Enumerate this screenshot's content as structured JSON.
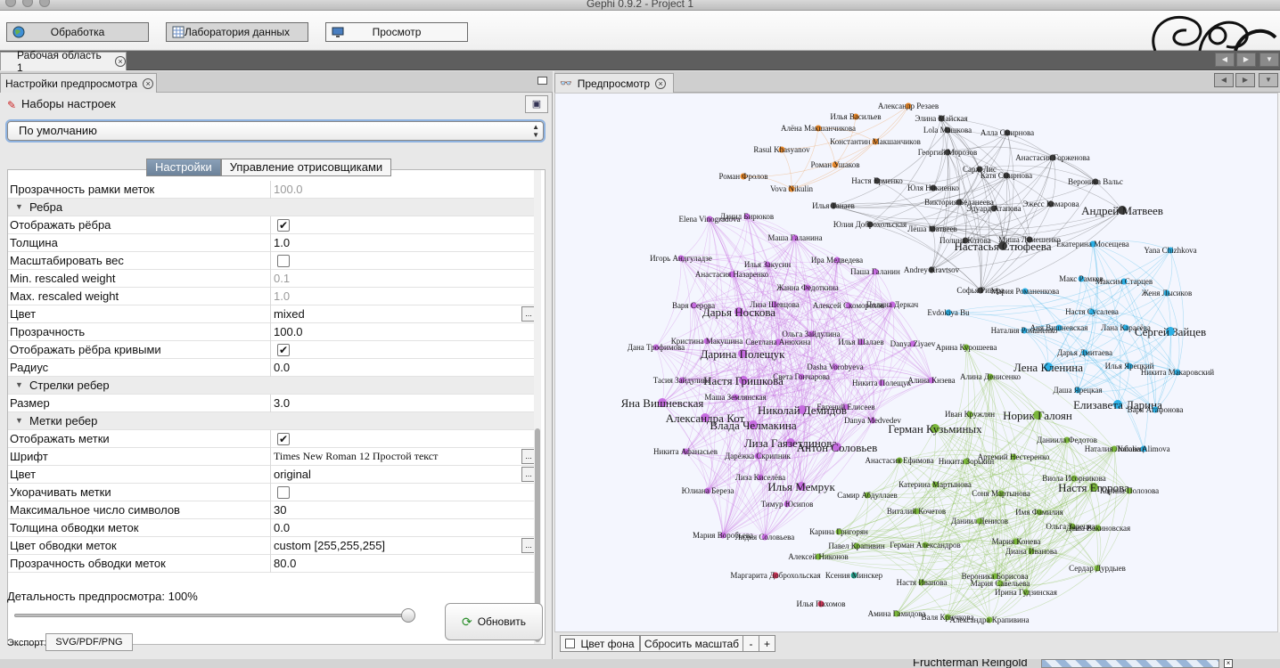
{
  "window": {
    "title": "Gephi 0.9.2 - Project 1"
  },
  "toolbar": {
    "overview_label": "Обработка",
    "datalab_label": "Лаборатория данных",
    "preview_label": "Просмотр"
  },
  "workspace": {
    "tab_label": "Рабочая область 1"
  },
  "left_panel": {
    "tab_label": "Настройки предпросмотра",
    "presets_label": "Наборы настроек",
    "preset_value": "По умолчанию",
    "subtabs": [
      "Настройки",
      "Управление отрисовщиками"
    ],
    "properties": [
      {
        "name": "Прозрачность рамки меток",
        "value": "100.0",
        "kind": "disabled"
      },
      {
        "name": "Ребра",
        "kind": "category"
      },
      {
        "name": "Отображать рёбра",
        "value": "✔",
        "kind": "checkbox"
      },
      {
        "name": "Толщина",
        "value": "1.0",
        "kind": "text"
      },
      {
        "name": "Масштабировать вес",
        "value": "",
        "kind": "checkbox"
      },
      {
        "name": "Min. rescaled weight",
        "value": "0.1",
        "kind": "disabled"
      },
      {
        "name": "Max. rescaled weight",
        "value": "1.0",
        "kind": "disabled"
      },
      {
        "name": "Цвет",
        "value": "mixed",
        "kind": "button"
      },
      {
        "name": "Прозрачность",
        "value": "100.0",
        "kind": "text"
      },
      {
        "name": "Отображать рёбра кривыми",
        "value": "✔",
        "kind": "checkbox"
      },
      {
        "name": "Радиус",
        "value": "0.0",
        "kind": "text"
      },
      {
        "name": "Стрелки ребер",
        "kind": "category"
      },
      {
        "name": "Размер",
        "value": "3.0",
        "kind": "text"
      },
      {
        "name": "Метки ребер",
        "kind": "category"
      },
      {
        "name": "Отображать метки",
        "value": "✔",
        "kind": "checkbox"
      },
      {
        "name": "Шрифт",
        "value": "Times New Roman 12 Простой текст",
        "kind": "font"
      },
      {
        "name": "Цвет",
        "value": "original",
        "kind": "button"
      },
      {
        "name": "Укорачивать метки",
        "value": "",
        "kind": "checkbox"
      },
      {
        "name": "Максимальное число символов",
        "value": "30",
        "kind": "text"
      },
      {
        "name": "Толщина обводки меток",
        "value": "0.0",
        "kind": "text"
      },
      {
        "name": "Цвет обводки меток",
        "value": "custom [255,255,255]",
        "kind": "button"
      },
      {
        "name": "Прозрачность обводки меток",
        "value": "80.0",
        "kind": "text"
      }
    ],
    "detail_label": "Детальность предпросмотра:",
    "detail_value": "100%",
    "detail_level": 1.0,
    "refresh_label": "Обновить",
    "export_label": "Экспорт:",
    "export_button": "SVG/PDF/PNG"
  },
  "right_panel": {
    "tab_label": "Предпросмотр",
    "bg_color_label": "Цвет фона",
    "reset_zoom_label": "Сбросить масштаб",
    "zoom_out_label": "-",
    "zoom_in_label": "+"
  },
  "graph": {
    "cluster_colors": {
      "black": "#3c3c3c",
      "orange": "#e8882a",
      "purple": "#c66be0",
      "blue": "#2bb0e6",
      "green": "#7ab63a",
      "teal": "#21a38f",
      "red": "#d2365a"
    },
    "nodes": [
      {
        "label": "Александр Резаев",
        "cluster": "orange"
      },
      {
        "label": "Илья Васильев",
        "cluster": "orange"
      },
      {
        "label": "Алёна Макшанчикова",
        "cluster": "orange"
      },
      {
        "label": "Константин Макшанчиков",
        "cluster": "orange"
      },
      {
        "label": "Rasul Khasyanov",
        "cluster": "orange"
      },
      {
        "label": "Роман Ушаков",
        "cluster": "orange"
      },
      {
        "label": "Роман Фролов",
        "cluster": "orange"
      },
      {
        "label": "Vova Nikulin",
        "cluster": "orange"
      },
      {
        "label": "Элина Майская",
        "cluster": "black"
      },
      {
        "label": "Lola Машкова",
        "cluster": "black"
      },
      {
        "label": "Алла Смирнова",
        "cluster": "black"
      },
      {
        "label": "Георгий Морозов",
        "cluster": "black"
      },
      {
        "label": "Анастасия Горженова",
        "cluster": "black"
      },
      {
        "label": "Сарж Лис",
        "cluster": "black"
      },
      {
        "label": "Катя Смирнова",
        "cluster": "black"
      },
      {
        "label": "Настя Ерменко",
        "cluster": "black"
      },
      {
        "label": "Юля Никиенко",
        "cluster": "black"
      },
      {
        "label": "Вероника Вальс",
        "cluster": "black"
      },
      {
        "label": "Виктория Беданеева",
        "cluster": "black"
      },
      {
        "label": "Эдуард Атапова",
        "cluster": "black"
      },
      {
        "label": "Эжесс Комарова",
        "cluster": "black"
      },
      {
        "label": "Андрей Матвеев",
        "cluster": "black"
      },
      {
        "label": "Илья Танаев",
        "cluster": "black"
      },
      {
        "label": "Юлия Доброхольская",
        "cluster": "black"
      },
      {
        "label": "Лёша Матвеев",
        "cluster": "black"
      },
      {
        "label": "Полина Котова",
        "cluster": "black"
      },
      {
        "label": "Настасья Стюфеева",
        "cluster": "black"
      },
      {
        "label": "Миша Лемешенко",
        "cluster": "black"
      },
      {
        "label": "Andrey Kravtsov",
        "cluster": "black"
      },
      {
        "label": "Софья Ривера",
        "cluster": "black"
      },
      {
        "label": "Данил Бирюков",
        "cluster": "purple"
      },
      {
        "label": "Elena Vinogradova",
        "cluster": "purple"
      },
      {
        "label": "Маша Галанина",
        "cluster": "purple"
      },
      {
        "label": "Игорь Андгуладзе",
        "cluster": "purple"
      },
      {
        "label": "Илья Закусин",
        "cluster": "purple"
      },
      {
        "label": "Ира Медведева",
        "cluster": "purple"
      },
      {
        "label": "Анастасия Назаренко",
        "cluster": "purple"
      },
      {
        "label": "Паша Галанин",
        "cluster": "purple"
      },
      {
        "label": "Жанна Федоткина",
        "cluster": "purple"
      },
      {
        "label": "Варя Серова",
        "cluster": "purple"
      },
      {
        "label": "Лиза Шевцова",
        "cluster": "purple"
      },
      {
        "label": "Алексей Скоморохов",
        "cluster": "purple"
      },
      {
        "label": "Полина Деркач",
        "cluster": "purple"
      },
      {
        "label": "Дарья Носкова",
        "cluster": "purple"
      },
      {
        "label": "Ольга Зайдулина",
        "cluster": "purple"
      },
      {
        "label": "Кристина Макушина",
        "cluster": "purple"
      },
      {
        "label": "Светлана Анюхина",
        "cluster": "purple"
      },
      {
        "label": "Илья Шалаев",
        "cluster": "purple"
      },
      {
        "label": "Danya Ziyaev",
        "cluster": "purple"
      },
      {
        "label": "Дана Трофимова",
        "cluster": "purple"
      },
      {
        "label": "Дарина Полещук",
        "cluster": "purple"
      },
      {
        "label": "Dasha Vorobyeva",
        "cluster": "purple"
      },
      {
        "label": "Тасия Зайдулина",
        "cluster": "purple"
      },
      {
        "label": "Света Гончарова",
        "cluster": "purple"
      },
      {
        "label": "Настя Гришкова",
        "cluster": "purple"
      },
      {
        "label": "Никита Полещук",
        "cluster": "purple"
      },
      {
        "label": "Маша Землянская",
        "cluster": "purple"
      },
      {
        "label": "Яна Вишневская",
        "cluster": "purple"
      },
      {
        "label": "Евгений Елисеев",
        "cluster": "purple"
      },
      {
        "label": "Николай Демидов",
        "cluster": "purple"
      },
      {
        "label": "Александра Кот",
        "cluster": "purple"
      },
      {
        "label": "Влада Челмакина",
        "cluster": "purple"
      },
      {
        "label": "Danya Medvedev",
        "cluster": "purple"
      },
      {
        "label": "Лиза Гаязетдинова",
        "cluster": "purple"
      },
      {
        "label": "Антон Соловьев",
        "cluster": "purple"
      },
      {
        "label": "Никита Афанасьев",
        "cluster": "purple"
      },
      {
        "label": "Дарёжка Скрипник",
        "cluster": "purple"
      },
      {
        "label": "Лиза Киселёва",
        "cluster": "purple"
      },
      {
        "label": "Илья Мемрук",
        "cluster": "purple"
      },
      {
        "label": "Юлиана Береза",
        "cluster": "purple"
      },
      {
        "label": "Тимур Юсипов",
        "cluster": "purple"
      },
      {
        "label": "Мария Воробьева",
        "cluster": "purple"
      },
      {
        "label": "Лидия Соловьева",
        "cluster": "purple"
      },
      {
        "label": "Алина Кнзева",
        "cluster": "purple"
      },
      {
        "label": "Екатерина Мосещева",
        "cluster": "blue"
      },
      {
        "label": "Yana Chizhkova",
        "cluster": "blue"
      },
      {
        "label": "Макс Рамков",
        "cluster": "blue"
      },
      {
        "label": "Максим Старцев",
        "cluster": "blue"
      },
      {
        "label": "Мария Романенкова",
        "cluster": "blue"
      },
      {
        "label": "Женя Лысиков",
        "cluster": "blue"
      },
      {
        "label": "Evdokiya Bu",
        "cluster": "blue"
      },
      {
        "label": "Настя Сусалева",
        "cluster": "blue"
      },
      {
        "label": "Наталия Романенко",
        "cluster": "blue"
      },
      {
        "label": "Аня Вишневская",
        "cluster": "blue"
      },
      {
        "label": "Лана Карасёва",
        "cluster": "blue"
      },
      {
        "label": "Сергей Зайцев",
        "cluster": "blue"
      },
      {
        "label": "Дарья Дмитаева",
        "cluster": "blue"
      },
      {
        "label": "Лена Кленина",
        "cluster": "blue"
      },
      {
        "label": "Илья Ярецкий",
        "cluster": "blue"
      },
      {
        "label": "Никита Макаровский",
        "cluster": "blue"
      },
      {
        "label": "Даша Ярецкая",
        "cluster": "blue"
      },
      {
        "label": "Елизавета Ларина",
        "cluster": "blue"
      },
      {
        "label": "Варя Агафонова",
        "cluster": "blue"
      },
      {
        "label": "Natalia Alimova",
        "cluster": "blue"
      },
      {
        "label": "Арина Курошеева",
        "cluster": "green"
      },
      {
        "label": "Алина Денисенко",
        "cluster": "green"
      },
      {
        "label": "Иван Кружлян",
        "cluster": "green"
      },
      {
        "label": "Норик Галоян",
        "cluster": "green"
      },
      {
        "label": "Герман Кузьминых",
        "cluster": "green"
      },
      {
        "label": "Даниила Федотов",
        "cluster": "green"
      },
      {
        "label": "Анастасия Ефимова",
        "cluster": "green"
      },
      {
        "label": "Никита Зорькин",
        "cluster": "green"
      },
      {
        "label": "Артемий Нестеренко",
        "cluster": "green"
      },
      {
        "label": "Наталия Лобовец",
        "cluster": "green"
      },
      {
        "label": "Самир Абдуллаев",
        "cluster": "green"
      },
      {
        "label": "Катерина Мартынова",
        "cluster": "green"
      },
      {
        "label": "Виола Исорникова",
        "cluster": "green"
      },
      {
        "label": "Соня Мартынова",
        "cluster": "green"
      },
      {
        "label": "Настя Егорова",
        "cluster": "green"
      },
      {
        "label": "Карина Полозова",
        "cluster": "green"
      },
      {
        "label": "Виталий Кочетов",
        "cluster": "green"
      },
      {
        "label": "Имя Фамилия",
        "cluster": "green"
      },
      {
        "label": "Даниил Денисов",
        "cluster": "green"
      },
      {
        "label": "Ольга Зарецкая",
        "cluster": "green"
      },
      {
        "label": "Карина Григорян",
        "cluster": "green"
      },
      {
        "label": "Даша Вакиновская",
        "cluster": "green"
      },
      {
        "label": "Павел Крапивин",
        "cluster": "green"
      },
      {
        "label": "Герман Александров",
        "cluster": "green"
      },
      {
        "label": "Мария Конева",
        "cluster": "green"
      },
      {
        "label": "Диана Иванова",
        "cluster": "green"
      },
      {
        "label": "Алексей Никонов",
        "cluster": "green"
      },
      {
        "label": "Сердар Дурдыев",
        "cluster": "green"
      },
      {
        "label": "Маргарита Доброхольская",
        "cluster": "red"
      },
      {
        "label": "Ксения Минскер",
        "cluster": "teal"
      },
      {
        "label": "Вероника Борисова",
        "cluster": "green"
      },
      {
        "label": "Настя Иванова",
        "cluster": "green"
      },
      {
        "label": "Мария Савельева",
        "cluster": "green"
      },
      {
        "label": "Ирина Гудзинская",
        "cluster": "green"
      },
      {
        "label": "Илья Пахомов",
        "cluster": "red"
      },
      {
        "label": "Амина Гамидова",
        "cluster": "green"
      },
      {
        "label": "Валя Крючкова",
        "cluster": "green"
      },
      {
        "label": "Александра Крапивина",
        "cluster": "green"
      }
    ]
  },
  "status": {
    "layout_name": "Fruchterman Reingold"
  }
}
